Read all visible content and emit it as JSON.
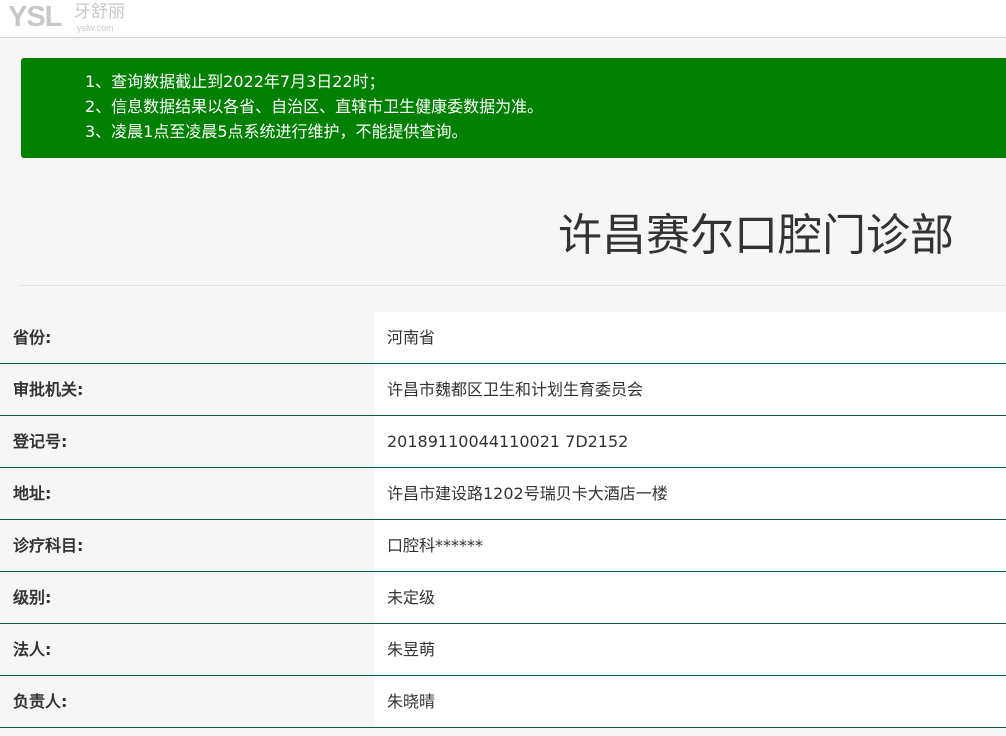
{
  "header": {
    "logo_mark": "YSL",
    "logo_cn": "牙舒丽",
    "logo_url": "yslw.com"
  },
  "notice": {
    "lines": [
      "1、查询数据截止到2022年7月3日22时；",
      "2、信息数据结果以各省、自治区、直辖市卫生健康委数据为准。",
      "3、凌晨1点至凌晨5点系统进行维护，不能提供查询。"
    ],
    "color": "#008000"
  },
  "title": "许昌赛尔口腔门诊部",
  "info": {
    "rows": [
      {
        "label": "省份:",
        "value": "河南省"
      },
      {
        "label": "审批机关:",
        "value": "许昌市魏都区卫生和计划生育委员会"
      },
      {
        "label": "登记号:",
        "value": "20189110044110021 7D2152"
      },
      {
        "label": "地址:",
        "value": "许昌市建设路1202号瑞贝卡大酒店一楼"
      },
      {
        "label": "诊疗科目:",
        "value": "口腔科******"
      },
      {
        "label": "级别:",
        "value": "未定级"
      },
      {
        "label": "法人:",
        "value": "朱昱萌"
      },
      {
        "label": "负责人:",
        "value": "朱晓晴"
      }
    ],
    "divider_color": "#0d5f3c"
  }
}
